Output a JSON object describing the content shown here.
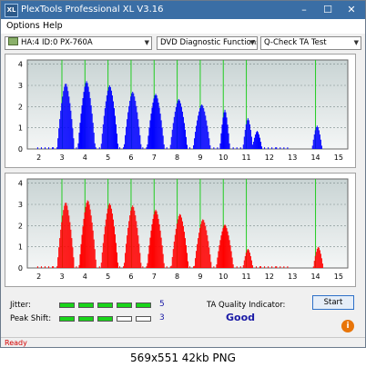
{
  "window": {
    "title": "PlexTools Professional XL V3.16",
    "icon_text": "XL",
    "controls": {
      "minimize": "–",
      "maximize": "☐",
      "close": "✕"
    }
  },
  "menu": [
    "Options",
    "Help"
  ],
  "toolbar": {
    "drive": "HA:4 ID:0  PX-760A",
    "function": "DVD Diagnostic Functions",
    "test": "Q-Check TA Test"
  },
  "chart_data": [
    {
      "type": "bar",
      "title": "",
      "color": "#0000ff",
      "x_ticks": [
        2,
        3,
        4,
        5,
        6,
        7,
        8,
        9,
        10,
        11,
        12,
        13,
        14,
        15
      ],
      "y_ticks": [
        0,
        1,
        2,
        3,
        4
      ],
      "xlim": [
        1.5,
        15.4
      ],
      "ylim": [
        0,
        4.2
      ],
      "green_lines": [
        3,
        4,
        5,
        6,
        7,
        8,
        9,
        10,
        11,
        14
      ],
      "peaks": [
        {
          "x": 3.15,
          "height": 3.1
        },
        {
          "x": 4.05,
          "height": 3.2
        },
        {
          "x": 5.05,
          "height": 3.0
        },
        {
          "x": 6.05,
          "height": 2.7
        },
        {
          "x": 7.05,
          "height": 2.6
        },
        {
          "x": 8.05,
          "height": 2.35
        },
        {
          "x": 9.05,
          "height": 2.1
        },
        {
          "x": 10.05,
          "height": 1.85
        },
        {
          "x": 11.05,
          "height": 1.45
        },
        {
          "x": 11.45,
          "height": 0.85
        },
        {
          "x": 14.05,
          "height": 1.1
        }
      ]
    },
    {
      "type": "bar",
      "title": "",
      "color": "#ff0000",
      "x_ticks": [
        2,
        3,
        4,
        5,
        6,
        7,
        8,
        9,
        10,
        11,
        12,
        13,
        14,
        15
      ],
      "y_ticks": [
        0,
        1,
        2,
        3,
        4
      ],
      "xlim": [
        1.5,
        15.4
      ],
      "ylim": [
        0,
        4.2
      ],
      "green_lines": [
        3,
        4,
        5,
        6,
        7,
        8,
        9,
        10,
        11,
        14
      ],
      "peaks": [
        {
          "x": 3.15,
          "height": 3.1
        },
        {
          "x": 4.1,
          "height": 3.2
        },
        {
          "x": 5.05,
          "height": 3.05
        },
        {
          "x": 6.05,
          "height": 2.95
        },
        {
          "x": 7.05,
          "height": 2.75
        },
        {
          "x": 8.1,
          "height": 2.55
        },
        {
          "x": 9.1,
          "height": 2.3
        },
        {
          "x": 10.05,
          "height": 2.05
        },
        {
          "x": 11.05,
          "height": 0.9
        },
        {
          "x": 14.1,
          "height": 1.0
        }
      ]
    }
  ],
  "jitter": {
    "label": "Jitter:",
    "value": "5",
    "filled": 5,
    "segments": 5
  },
  "peak_shift": {
    "label": "Peak Shift:",
    "value": "3",
    "filled": 3,
    "segments": 5
  },
  "ta_quality": {
    "label": "TA Quality Indicator:",
    "value": "Good"
  },
  "buttons": {
    "start": "Start",
    "info": "i"
  },
  "status": "Ready",
  "caption": "569x551  42kb  PNG",
  "colors": {
    "accent": "#3a6ea5",
    "meter_on": "#19d419",
    "status": "#d40000",
    "good": "#1a1aa6"
  }
}
